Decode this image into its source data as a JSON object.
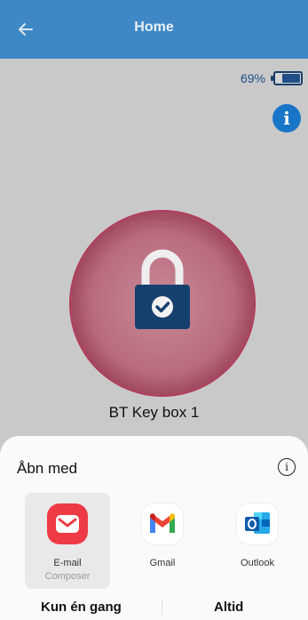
{
  "header": {
    "title": "Home"
  },
  "battery": {
    "percent_text": "69%",
    "level": 0.69
  },
  "device": {
    "name": "BT Key box 1"
  },
  "sheet": {
    "title": "Åbn med",
    "apps": [
      {
        "name": "E-mail",
        "sub": "Composer"
      },
      {
        "name": "Gmail",
        "sub": ""
      },
      {
        "name": "Outlook",
        "sub": ""
      }
    ],
    "actions": {
      "once": "Kun én gang",
      "always": "Altid"
    }
  },
  "colors": {
    "header": "#3f88c6",
    "accent": "#1875c7",
    "lock": "#1b3f6b",
    "ring": "#b96b7d"
  }
}
